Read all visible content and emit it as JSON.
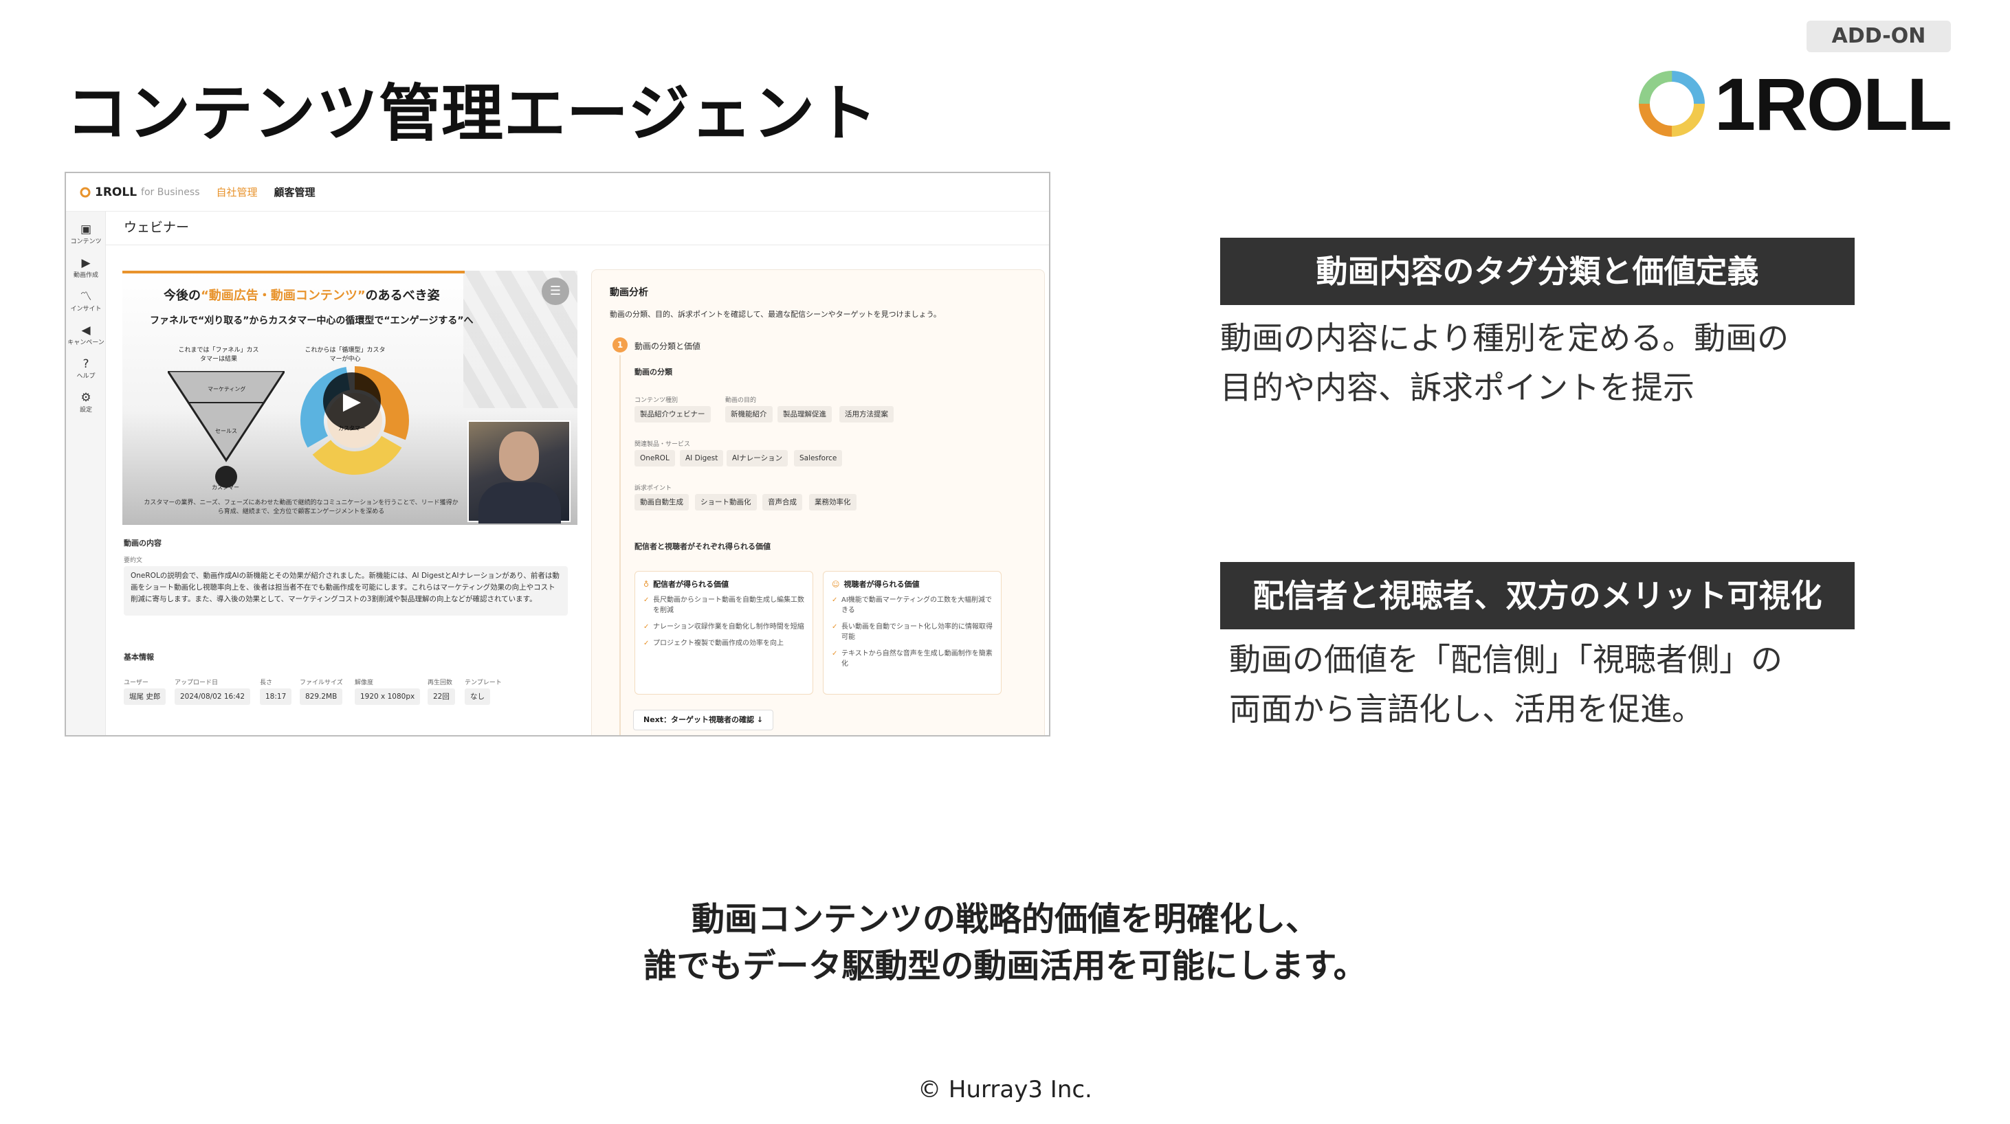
{
  "page": {
    "title": "コンテンツ管理エージェント",
    "addon_badge": "ADD-ON",
    "logo_text": "1ROLL",
    "copyright": "© Hurray3 Inc."
  },
  "app": {
    "brand": "1ROLL",
    "brand_sub": "for Business",
    "nav": [
      "自社管理",
      "顧客管理"
    ],
    "sidebar": [
      {
        "icon": "content-icon",
        "label": "コンテンツ"
      },
      {
        "icon": "video-create-icon",
        "label": "動画作成"
      },
      {
        "icon": "insight-icon",
        "label": "インサイト"
      },
      {
        "icon": "campaign-icon",
        "label": "キャンペーン"
      },
      {
        "icon": "help-icon",
        "label": "ヘルプ"
      },
      {
        "icon": "settings-icon",
        "label": "設定"
      }
    ],
    "page_heading": "ウェビナー",
    "video": {
      "title_pre": "今後の",
      "title_highlight": "“動画広告・動画コンテンツ”",
      "title_post": "のあるべき姿",
      "subtitle": "ファネルで“刈り取る”からカスタマー中心の循環型で“エンゲージする”へ",
      "left_label": "これまでは「ファネル」カスタマーは結果",
      "right_label": "これからは「循環型」カスタマーが中心",
      "funnel_labels": [
        "マーケティング",
        "セールス",
        "カスタマー"
      ],
      "cycle_center": "カスタマー",
      "caption": "カスタマーの業界、ニーズ、フェーズにあわせた動画で継続的なコミュニケーションを行うことで、リード獲得から育成、継続まで、全方位で顧客エンゲージメントを深める"
    },
    "content_section": "動画の内容",
    "summary_label": "要約文",
    "summary_text": "OneROLの説明会で、動画作成AIの新機能とその効果が紹介されました。新機能には、AI DigestとAIナレーションがあり、前者は動画をショート動画化し視聴率向上を、後者は担当者不在でも動画作成を可能にします。これらはマーケティング効果の向上やコスト削減に寄与します。また、導入後の効果として、マーケティングコストの3割削減や製品理解の向上などが確認されています。",
    "basic_info_label": "基本情報",
    "basic_info": [
      {
        "label": "ユーザー",
        "value": "堀尾 史郎"
      },
      {
        "label": "アップロード日",
        "value": "2024/08/02 16:42"
      },
      {
        "label": "長さ",
        "value": "18:17"
      },
      {
        "label": "ファイルサイズ",
        "value": "829.2MB"
      },
      {
        "label": "解像度",
        "value": "1920 x 1080px"
      },
      {
        "label": "再生回数",
        "value": "22回"
      },
      {
        "label": "テンプレート",
        "value": "なし"
      }
    ],
    "analysis": {
      "title": "動画分析",
      "description": "動画の分類、目的、訴求ポイントを確認して、最適な配信シーンやターゲットを見つけましょう。",
      "step_number": "1",
      "step_title": "動画の分類と価値",
      "classification_title": "動画の分類",
      "content_type_label": "コンテンツ種別",
      "content_type": [
        "製品紹介ウェビナー"
      ],
      "purpose_label": "動画の目的",
      "purposes": [
        "新機能紹介",
        "製品理解促進",
        "活用方法提案"
      ],
      "related_label": "関連製品・サービス",
      "related": [
        "OneROL",
        "AI Digest",
        "AIナレーション",
        "Salesforce"
      ],
      "appeal_label": "訴求ポイント",
      "appeals": [
        "動画自動生成",
        "ショート動画化",
        "音声合成",
        "業務効率化"
      ],
      "value_title": "配信者と視聴者がそれぞれ得られる価値",
      "sender_title": "配信者が得られる価値",
      "sender_items": [
        "長尺動画からショート動画を自動生成し編集工数を削減",
        "ナレーション収録作業を自動化し制作時間を短縮",
        "プロジェクト複製で動画作成の効率を向上"
      ],
      "viewer_title": "視聴者が得られる価値",
      "viewer_items": [
        "AI機能で動画マーケティングの工数を大幅削減できる",
        "長い動画を自動でショート化し効率的に情報取得可能",
        "テキストから自然な音声を生成し動画制作を簡素化"
      ],
      "next_button": "Next：ターゲット視聴者の確認 ↓"
    }
  },
  "features": [
    {
      "heading": "動画内容のタグ分類と価値定義",
      "lines": [
        "動画の内容により種別を定める。動画の",
        "目的や内容、訴求ポイントを提示"
      ]
    },
    {
      "heading": "配信者と視聴者、双方のメリット可視化",
      "lines": [
        "動画の価値を「配信側」「視聴者側」の",
        "両面から言語化し、活用を促進。"
      ]
    }
  ],
  "closing": [
    "動画コンテンツの戦略的価値を明確化し、",
    "誰でもデータ駆動型の動画活用を可能にします。"
  ],
  "colors": {
    "accent": "#e8932c",
    "heading_bg": "#333333"
  }
}
